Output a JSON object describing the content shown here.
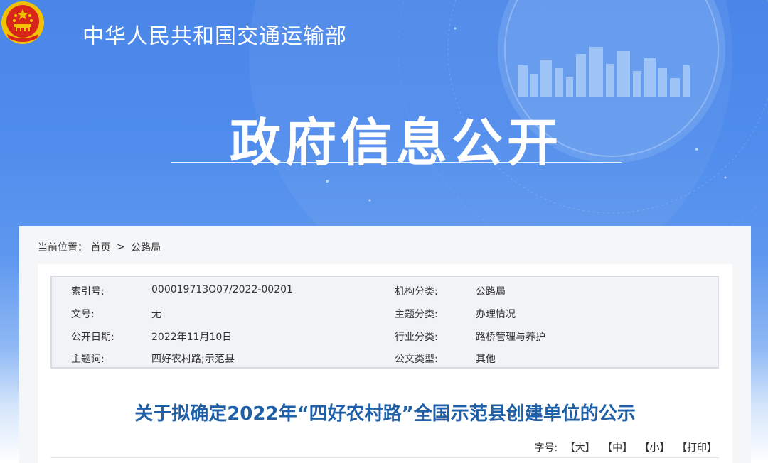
{
  "header": {
    "ministry_name": "中华人民共和国交通运输部",
    "banner_title": "政府信息公开"
  },
  "breadcrumb": {
    "prefix": "当前位置：",
    "home": "首页",
    "separator": ">",
    "current": "公路局"
  },
  "info": {
    "rows": [
      {
        "label1": "索引号:",
        "value1": "000019713O07/2022-00201",
        "label2": "机构分类:",
        "value2": "公路局"
      },
      {
        "label1": "文号:",
        "value1": "无",
        "label2": "主题分类:",
        "value2": "办理情况"
      },
      {
        "label1": "公开日期:",
        "value1": "2022年11月10日",
        "label2": "行业分类:",
        "value2": "路桥管理与养护"
      },
      {
        "label1": "主题词:",
        "value1": "四好农村路;示范县",
        "label2": "公文类型:",
        "value2": "其他"
      }
    ]
  },
  "document": {
    "title": "关于拟确定2022年“四好农村路”全国示范县创建单位的公示"
  },
  "font_size": {
    "label": "字号:",
    "large": "【大】",
    "medium": "【中】",
    "small": "【小】",
    "print": "【打印】"
  },
  "colors": {
    "banner_blue": "#4a86e8",
    "title_blue": "#1f5fa7",
    "emblem_red": "#d9261c",
    "emblem_gold": "#f2c200"
  }
}
